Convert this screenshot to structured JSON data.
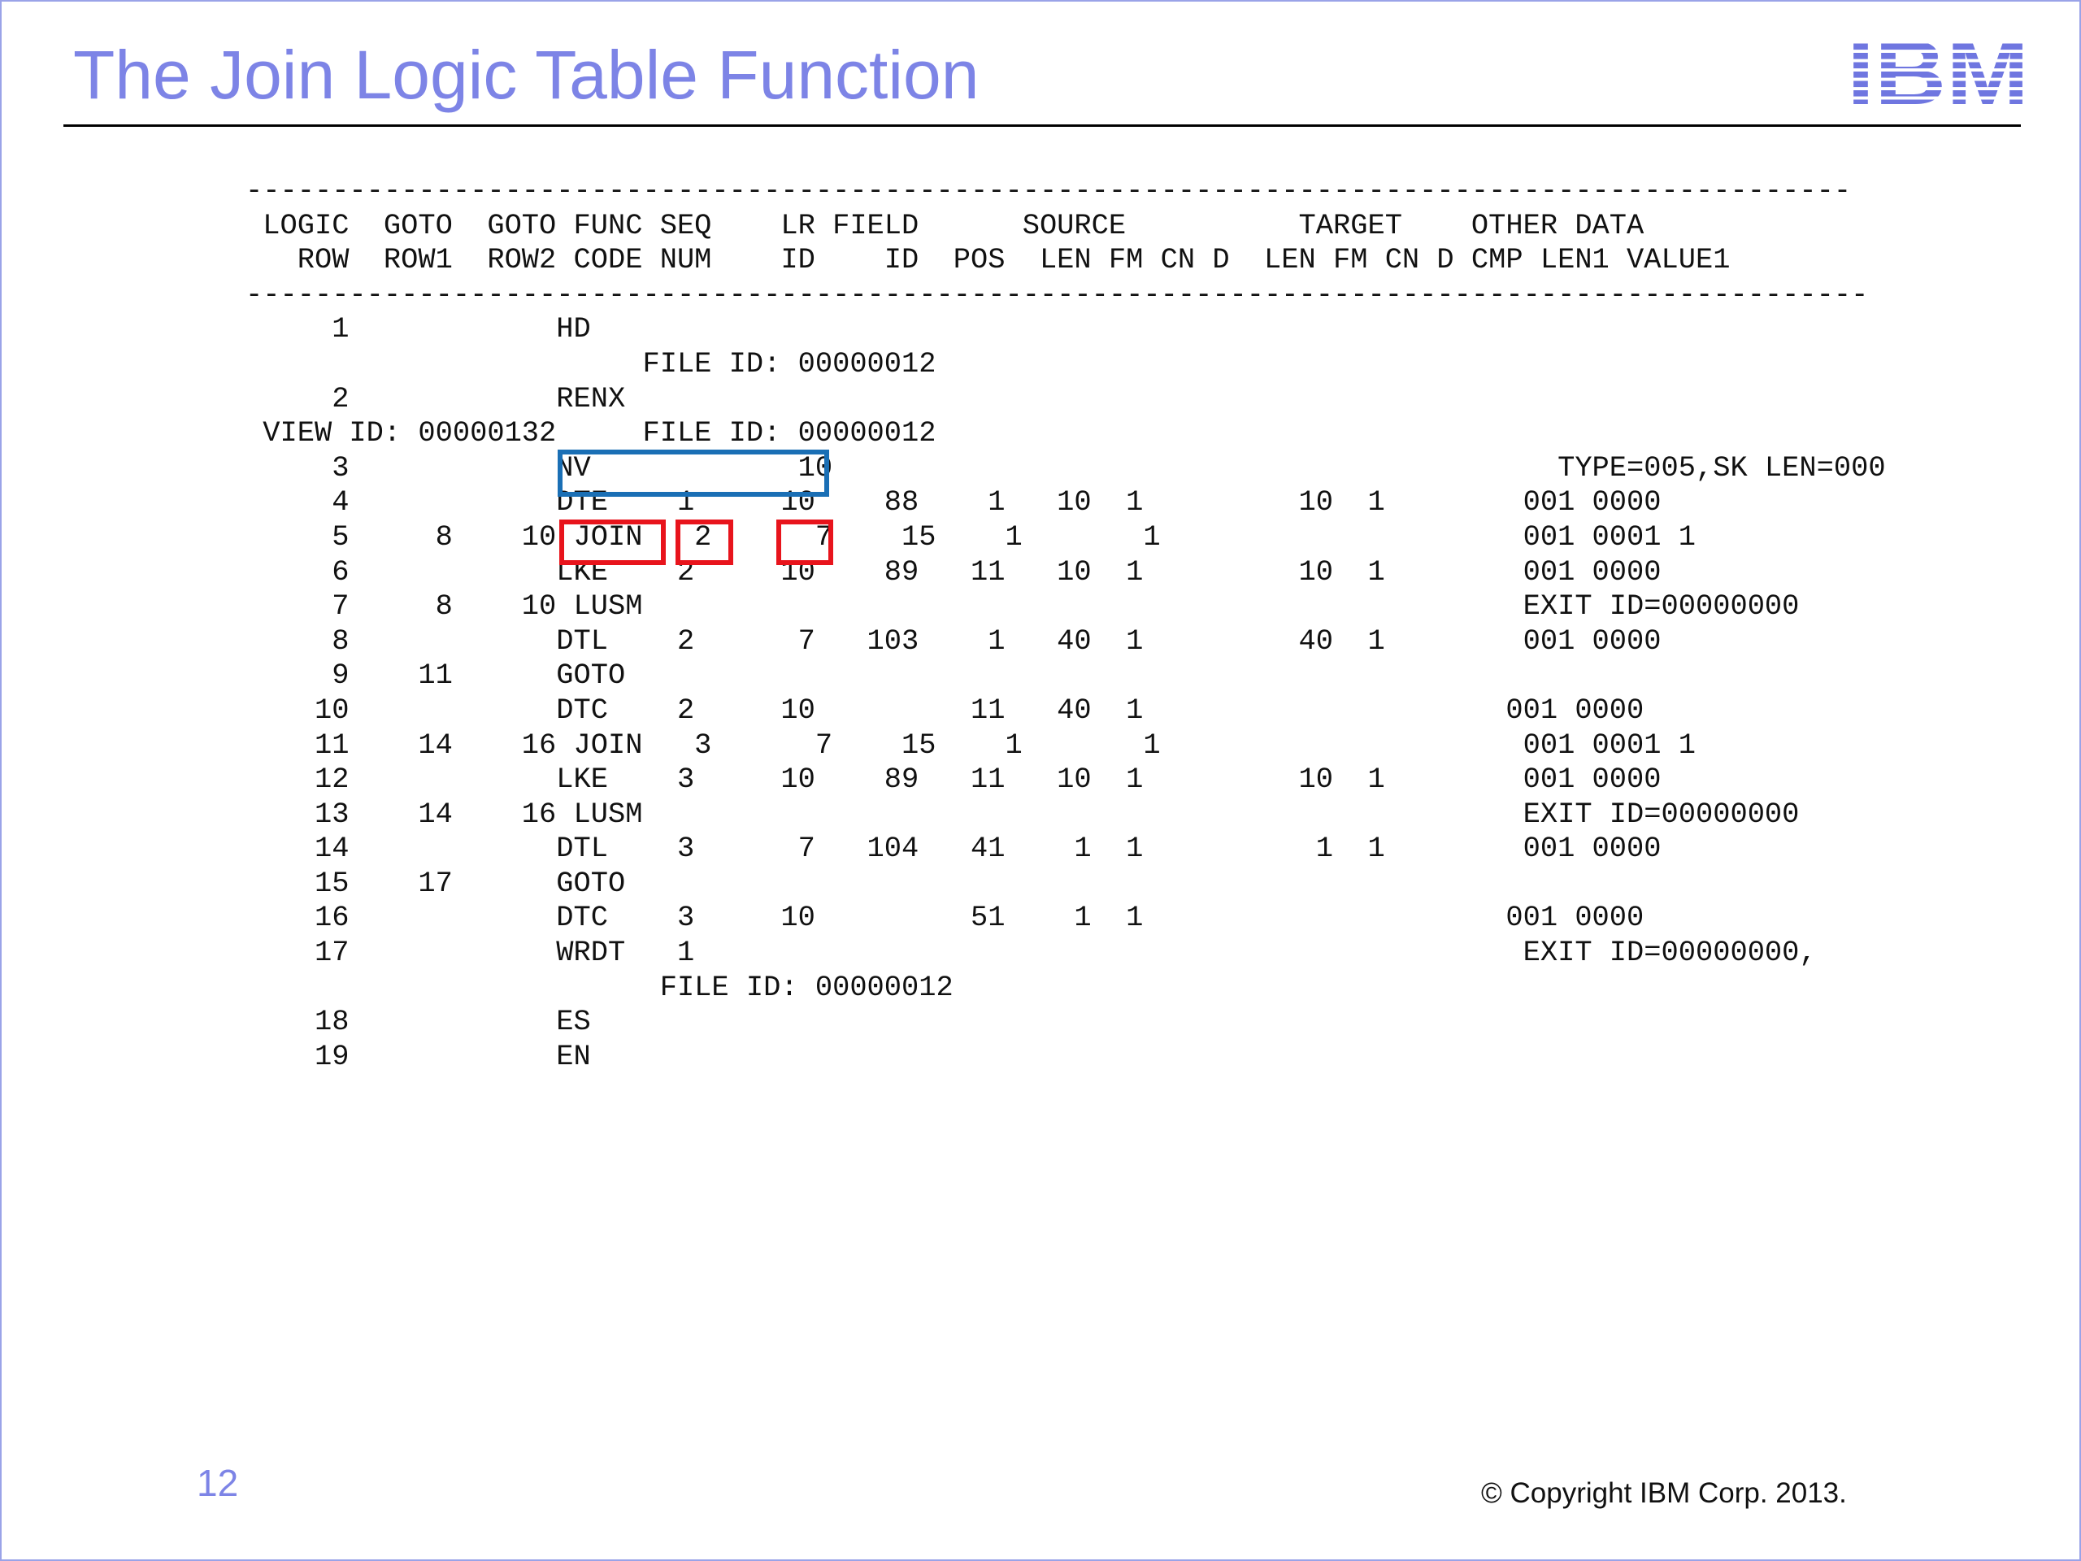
{
  "slide": {
    "title": "The Join Logic Table Function",
    "page_number": "12",
    "copyright": "© Copyright IBM Corp. 2013.",
    "logo_text": "IBM"
  },
  "listing": {
    "separator_top": "---------------------------------------------------------------------------------------------",
    "header_line1": " LOGIC  GOTO  GOTO FUNC SEQ    LR FIELD      SOURCE          TARGET    OTHER DATA",
    "header_line2": "   ROW  ROW1  ROW2 CODE NUM    ID    ID  POS  LEN FM CN D  LEN FM CN D CMP LEN1 VALUE1",
    "separator_bottom": "----------------------------------------------------------------------------------------------",
    "rows": [
      "     1            HD",
      "                       FILE ID: 00000012",
      "     2            RENX",
      " VIEW ID: 00000132     FILE ID: 00000012",
      "     3            NV            10                                          TYPE=005,SK LEN=000",
      "     4            DTE    1     10    88    1   10  1         10  1        001 0000",
      "     5     8    10 JOIN   2      7    15    1       1                     001 0001 1",
      "     6            LKE    2     10    89   11   10  1         10  1        001 0000",
      "     7     8    10 LUSM                                                   EXIT ID=00000000",
      "     8            DTL    2      7   103    1   40  1         40  1        001 0000",
      "     9    11      GOTO",
      "    10            DTC    2     10         11   40  1                     001 0000",
      "    11    14    16 JOIN   3      7    15    1       1                     001 0001 1",
      "    12            LKE    3     10    89   11   10  1         10  1        001 0000",
      "    13    14    16 LUSM                                                   EXIT ID=00000000",
      "    14            DTL    3      7   104   41    1  1          1  1        001 0000",
      "    15    17      GOTO",
      "    16            DTC    3     10         51    1  1                     001 0000",
      "    17            WRDT   1                                                EXIT ID=00000000,",
      "                        FILE ID: 00000012",
      "    18            ES",
      "    19            EN"
    ]
  },
  "highlights": [
    {
      "label": "NV row",
      "color": "#1a6fb5"
    },
    {
      "label": "JOIN function code",
      "color": "#e8141c"
    },
    {
      "label": "SEQ NUM 2",
      "color": "#e8141c"
    },
    {
      "label": "LR ID 7",
      "color": "#e8141c"
    }
  ]
}
